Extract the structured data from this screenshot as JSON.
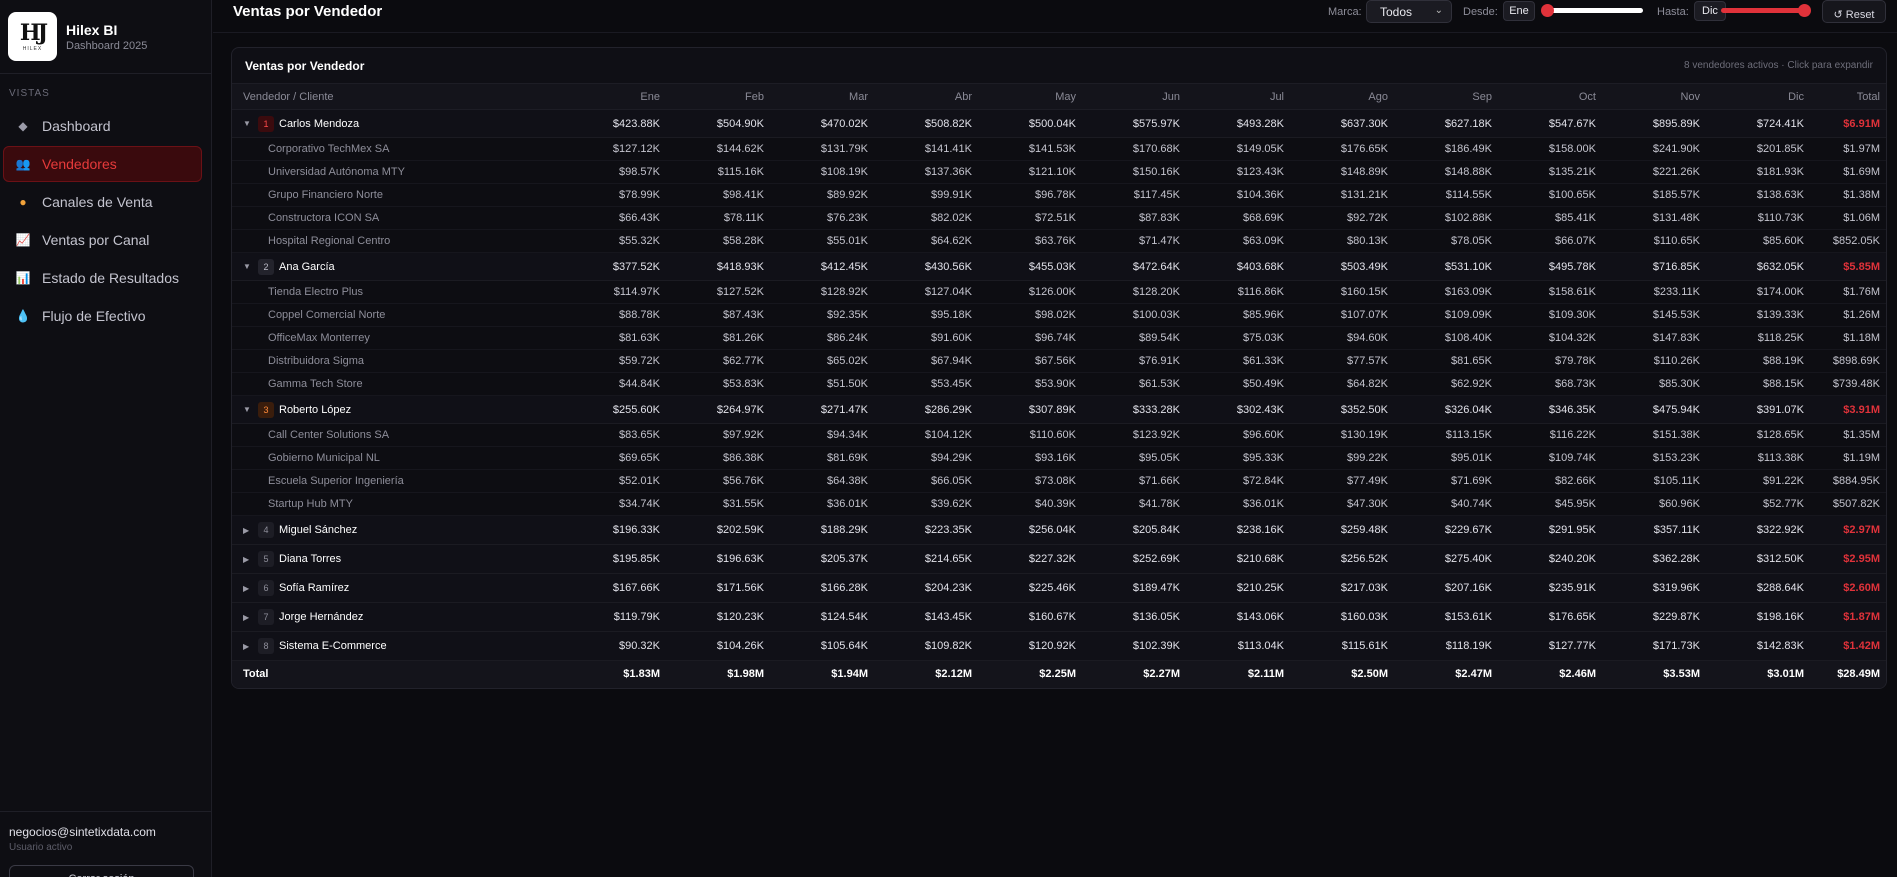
{
  "app": {
    "title": "Hilex BI",
    "subtitle": "Dashboard 2025",
    "logo_mark": "HJ",
    "logo_sub": "HILEX"
  },
  "sidebar": {
    "section": "VISTAS",
    "items": [
      {
        "label": "Dashboard",
        "icon": "diamond-icon",
        "glyph": "◆",
        "color": "#9a9aa8",
        "active": false
      },
      {
        "label": "Vendedores",
        "icon": "users-icon",
        "glyph": "👥",
        "color": "#6b7cff",
        "active": true
      },
      {
        "label": "Canales de Venta",
        "icon": "palette-icon",
        "glyph": "●",
        "color": "#f2a23a",
        "active": false
      },
      {
        "label": "Ventas por Canal",
        "icon": "chart-line-icon",
        "glyph": "📈",
        "color": "#5aa0ff",
        "active": false
      },
      {
        "label": "Estado de Resultados",
        "icon": "bar-chart-icon",
        "glyph": "📊",
        "color": "#7a8cff",
        "active": false
      },
      {
        "label": "Flujo de Efectivo",
        "icon": "droplet-icon",
        "glyph": "💧",
        "color": "#3aa0ff",
        "active": false
      }
    ],
    "user_email": "negocios@sintetixdata.com",
    "user_status": "Usuario activo",
    "logout_label": "Cerrar sesión"
  },
  "header": {
    "title": "Ventas por Vendedor",
    "brand_label": "Marca:",
    "brand_value": "Todos",
    "from_label": "Desde:",
    "from_value": "Ene",
    "to_label": "Hasta:",
    "to_value": "Dic",
    "reset_label": "↺ Reset",
    "accent": "#e0323a"
  },
  "card": {
    "title": "Ventas por Vendedor",
    "hint": "8 vendedores activos · Click para expandir"
  },
  "table": {
    "columns": [
      "Vendedor / Cliente",
      "Ene",
      "Feb",
      "Mar",
      "Abr",
      "May",
      "Jun",
      "Jul",
      "Ago",
      "Sep",
      "Oct",
      "Nov",
      "Dic",
      "Total"
    ],
    "rows": [
      {
        "type": "seller",
        "rank": "1",
        "expanded": true,
        "name": "Carlos Mendoza",
        "values": [
          "$423.88K",
          "$504.90K",
          "$470.02K",
          "$508.82K",
          "$500.04K",
          "$575.97K",
          "$493.28K",
          "$637.30K",
          "$627.18K",
          "$547.67K",
          "$895.89K",
          "$724.41K",
          "$6.91M"
        ]
      },
      {
        "type": "client",
        "name": "Corporativo TechMex SA",
        "values": [
          "$127.12K",
          "$144.62K",
          "$131.79K",
          "$141.41K",
          "$141.53K",
          "$170.68K",
          "$149.05K",
          "$176.65K",
          "$186.49K",
          "$158.00K",
          "$241.90K",
          "$201.85K",
          "$1.97M"
        ]
      },
      {
        "type": "client",
        "name": "Universidad Autónoma MTY",
        "values": [
          "$98.57K",
          "$115.16K",
          "$108.19K",
          "$137.36K",
          "$121.10K",
          "$150.16K",
          "$123.43K",
          "$148.89K",
          "$148.88K",
          "$135.21K",
          "$221.26K",
          "$181.93K",
          "$1.69M"
        ]
      },
      {
        "type": "client",
        "name": "Grupo Financiero Norte",
        "values": [
          "$78.99K",
          "$98.41K",
          "$89.92K",
          "$99.91K",
          "$96.78K",
          "$117.45K",
          "$104.36K",
          "$131.21K",
          "$114.55K",
          "$100.65K",
          "$185.57K",
          "$138.63K",
          "$1.38M"
        ]
      },
      {
        "type": "client",
        "name": "Constructora ICON SA",
        "values": [
          "$66.43K",
          "$78.11K",
          "$76.23K",
          "$82.02K",
          "$72.51K",
          "$87.83K",
          "$68.69K",
          "$92.72K",
          "$102.88K",
          "$85.41K",
          "$131.48K",
          "$110.73K",
          "$1.06M"
        ]
      },
      {
        "type": "client",
        "name": "Hospital Regional Centro",
        "values": [
          "$55.32K",
          "$58.28K",
          "$55.01K",
          "$64.62K",
          "$63.76K",
          "$71.47K",
          "$63.09K",
          "$80.13K",
          "$78.05K",
          "$66.07K",
          "$110.65K",
          "$85.60K",
          "$852.05K"
        ]
      },
      {
        "type": "seller",
        "rank": "2",
        "expanded": true,
        "name": "Ana García",
        "values": [
          "$377.52K",
          "$418.93K",
          "$412.45K",
          "$430.56K",
          "$455.03K",
          "$472.64K",
          "$403.68K",
          "$503.49K",
          "$531.10K",
          "$495.78K",
          "$716.85K",
          "$632.05K",
          "$5.85M"
        ]
      },
      {
        "type": "client",
        "name": "Tienda Electro Plus",
        "values": [
          "$114.97K",
          "$127.52K",
          "$128.92K",
          "$127.04K",
          "$126.00K",
          "$128.20K",
          "$116.86K",
          "$160.15K",
          "$163.09K",
          "$158.61K",
          "$233.11K",
          "$174.00K",
          "$1.76M"
        ]
      },
      {
        "type": "client",
        "name": "Coppel Comercial Norte",
        "values": [
          "$88.78K",
          "$87.43K",
          "$92.35K",
          "$95.18K",
          "$98.02K",
          "$100.03K",
          "$85.96K",
          "$107.07K",
          "$109.09K",
          "$109.30K",
          "$145.53K",
          "$139.33K",
          "$1.26M"
        ]
      },
      {
        "type": "client",
        "name": "OfficeMax Monterrey",
        "values": [
          "$81.63K",
          "$81.26K",
          "$86.24K",
          "$91.60K",
          "$96.74K",
          "$89.54K",
          "$75.03K",
          "$94.60K",
          "$108.40K",
          "$104.32K",
          "$147.83K",
          "$118.25K",
          "$1.18M"
        ]
      },
      {
        "type": "client",
        "name": "Distribuidora Sigma",
        "values": [
          "$59.72K",
          "$62.77K",
          "$65.02K",
          "$67.94K",
          "$67.56K",
          "$76.91K",
          "$61.33K",
          "$77.57K",
          "$81.65K",
          "$79.78K",
          "$110.26K",
          "$88.19K",
          "$898.69K"
        ]
      },
      {
        "type": "client",
        "name": "Gamma Tech Store",
        "values": [
          "$44.84K",
          "$53.83K",
          "$51.50K",
          "$53.45K",
          "$53.90K",
          "$61.53K",
          "$50.49K",
          "$64.82K",
          "$62.92K",
          "$68.73K",
          "$85.30K",
          "$88.15K",
          "$739.48K"
        ]
      },
      {
        "type": "seller",
        "rank": "3",
        "expanded": true,
        "name": "Roberto López",
        "values": [
          "$255.60K",
          "$264.97K",
          "$271.47K",
          "$286.29K",
          "$307.89K",
          "$333.28K",
          "$302.43K",
          "$352.50K",
          "$326.04K",
          "$346.35K",
          "$475.94K",
          "$391.07K",
          "$3.91M"
        ]
      },
      {
        "type": "client",
        "name": "Call Center Solutions SA",
        "values": [
          "$83.65K",
          "$97.92K",
          "$94.34K",
          "$104.12K",
          "$110.60K",
          "$123.92K",
          "$96.60K",
          "$130.19K",
          "$113.15K",
          "$116.22K",
          "$151.38K",
          "$128.65K",
          "$1.35M"
        ]
      },
      {
        "type": "client",
        "name": "Gobierno Municipal NL",
        "values": [
          "$69.65K",
          "$86.38K",
          "$81.69K",
          "$94.29K",
          "$93.16K",
          "$95.05K",
          "$95.33K",
          "$99.22K",
          "$95.01K",
          "$109.74K",
          "$153.23K",
          "$113.38K",
          "$1.19M"
        ]
      },
      {
        "type": "client",
        "name": "Escuela Superior Ingeniería",
        "values": [
          "$52.01K",
          "$56.76K",
          "$64.38K",
          "$66.05K",
          "$73.08K",
          "$71.66K",
          "$72.84K",
          "$77.49K",
          "$71.69K",
          "$82.66K",
          "$105.11K",
          "$91.22K",
          "$884.95K"
        ]
      },
      {
        "type": "client",
        "name": "Startup Hub MTY",
        "values": [
          "$34.74K",
          "$31.55K",
          "$36.01K",
          "$39.62K",
          "$40.39K",
          "$41.78K",
          "$36.01K",
          "$47.30K",
          "$40.74K",
          "$45.95K",
          "$60.96K",
          "$52.77K",
          "$507.82K"
        ]
      },
      {
        "type": "seller",
        "rank": "4",
        "expanded": false,
        "name": "Miguel Sánchez",
        "values": [
          "$196.33K",
          "$202.59K",
          "$188.29K",
          "$223.35K",
          "$256.04K",
          "$205.84K",
          "$238.16K",
          "$259.48K",
          "$229.67K",
          "$291.95K",
          "$357.11K",
          "$322.92K",
          "$2.97M"
        ]
      },
      {
        "type": "seller",
        "rank": "5",
        "expanded": false,
        "name": "Diana Torres",
        "values": [
          "$195.85K",
          "$196.63K",
          "$205.37K",
          "$214.65K",
          "$227.32K",
          "$252.69K",
          "$210.68K",
          "$256.52K",
          "$275.40K",
          "$240.20K",
          "$362.28K",
          "$312.50K",
          "$2.95M"
        ]
      },
      {
        "type": "seller",
        "rank": "6",
        "expanded": false,
        "name": "Sofía Ramírez",
        "values": [
          "$167.66K",
          "$171.56K",
          "$166.28K",
          "$204.23K",
          "$225.46K",
          "$189.47K",
          "$210.25K",
          "$217.03K",
          "$207.16K",
          "$235.91K",
          "$319.96K",
          "$288.64K",
          "$2.60M"
        ]
      },
      {
        "type": "seller",
        "rank": "7",
        "expanded": false,
        "name": "Jorge Hernández",
        "values": [
          "$119.79K",
          "$120.23K",
          "$124.54K",
          "$143.45K",
          "$160.67K",
          "$136.05K",
          "$143.06K",
          "$160.03K",
          "$153.61K",
          "$176.65K",
          "$229.87K",
          "$198.16K",
          "$1.87M"
        ]
      },
      {
        "type": "seller",
        "rank": "8",
        "expanded": false,
        "name": "Sistema E-Commerce",
        "values": [
          "$90.32K",
          "$104.26K",
          "$105.64K",
          "$109.82K",
          "$120.92K",
          "$102.39K",
          "$113.04K",
          "$115.61K",
          "$118.19K",
          "$127.77K",
          "$171.73K",
          "$142.83K",
          "$1.42M"
        ]
      }
    ],
    "total": {
      "label": "Total",
      "values": [
        "$1.83M",
        "$1.98M",
        "$1.94M",
        "$2.12M",
        "$2.25M",
        "$2.27M",
        "$2.11M",
        "$2.50M",
        "$2.47M",
        "$2.46M",
        "$3.53M",
        "$3.01M",
        "$28.49M"
      ]
    }
  }
}
